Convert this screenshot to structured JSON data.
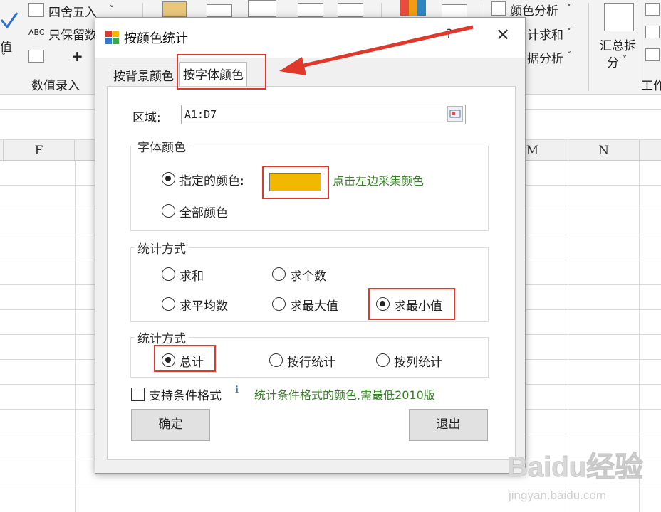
{
  "ribbon": {
    "round_label": "四舍五入",
    "keep_label": "只保留数",
    "abc": "ABC",
    "value_frag": "值",
    "group_label": "数值录入",
    "color_analysis": "颜色分析",
    "sum_frag": "计求和",
    "data_analysis_frag": "据分析",
    "summary_split_1": "汇总拆",
    "summary_split_2": "分",
    "work_frag": "工作",
    "plus": "+",
    "chevron": "˅"
  },
  "sheet": {
    "columns": [
      "F",
      "M",
      "N"
    ]
  },
  "dialog": {
    "title": "按颜色统计",
    "help": "?",
    "close": "✕",
    "tabs": [
      "按背景颜色",
      "按字体颜色"
    ],
    "range_label": "区域:",
    "range_value": "A1:D7",
    "font_color_group": "字体颜色",
    "specified_color": "指定的颜色:",
    "pick_hint": "点击左边采集颜色",
    "all_colors": "全部颜色",
    "stat_method_group": "统计方式",
    "options": {
      "sum": "求和",
      "count": "求个数",
      "average": "求平均数",
      "max": "求最大值",
      "min": "求最小值"
    },
    "stat_method_group2": "统计方式",
    "scope": {
      "total": "总计",
      "by_row": "按行统计",
      "by_col": "按列统计"
    },
    "cond_format_label": "支持条件格式",
    "cond_format_hint": "统计条件格式的颜色,需最低2010版",
    "ok": "确定",
    "exit": "退出"
  },
  "colors": {
    "swatch": "#f2b800",
    "highlight": "#e0382a",
    "hint_text": "#3a7d2a"
  },
  "watermark": {
    "brand": "Baidu经验",
    "url": "jingyan.baidu.com"
  }
}
